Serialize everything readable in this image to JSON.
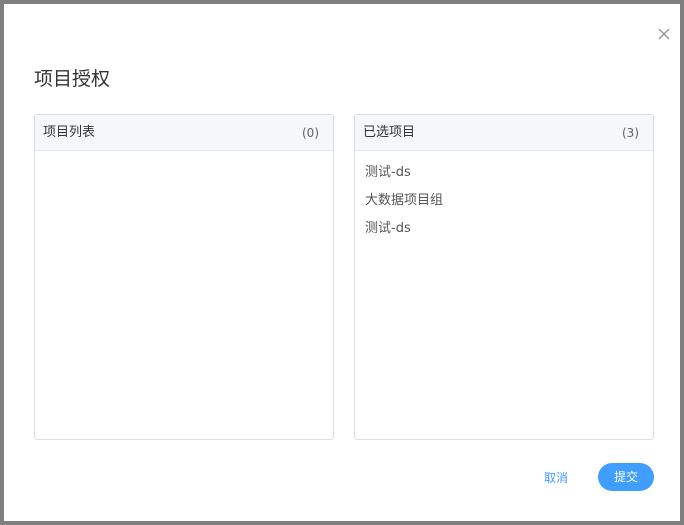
{
  "dialog": {
    "title": "项目授权",
    "close_icon": "close-icon"
  },
  "left_panel": {
    "title": "项目列表",
    "count": "(0)",
    "items": []
  },
  "right_panel": {
    "title": "已选项目",
    "count": "(3)",
    "items": [
      {
        "label": "测试-ds"
      },
      {
        "label": "大数据项目组"
      },
      {
        "label": "测试-ds"
      }
    ]
  },
  "footer": {
    "cancel_label": "取消",
    "submit_label": "提交"
  },
  "colors": {
    "primary": "#409eff",
    "overlay": "#7f7f7f",
    "header_bg": "#f5f7fa",
    "border": "#dcdfe6"
  }
}
